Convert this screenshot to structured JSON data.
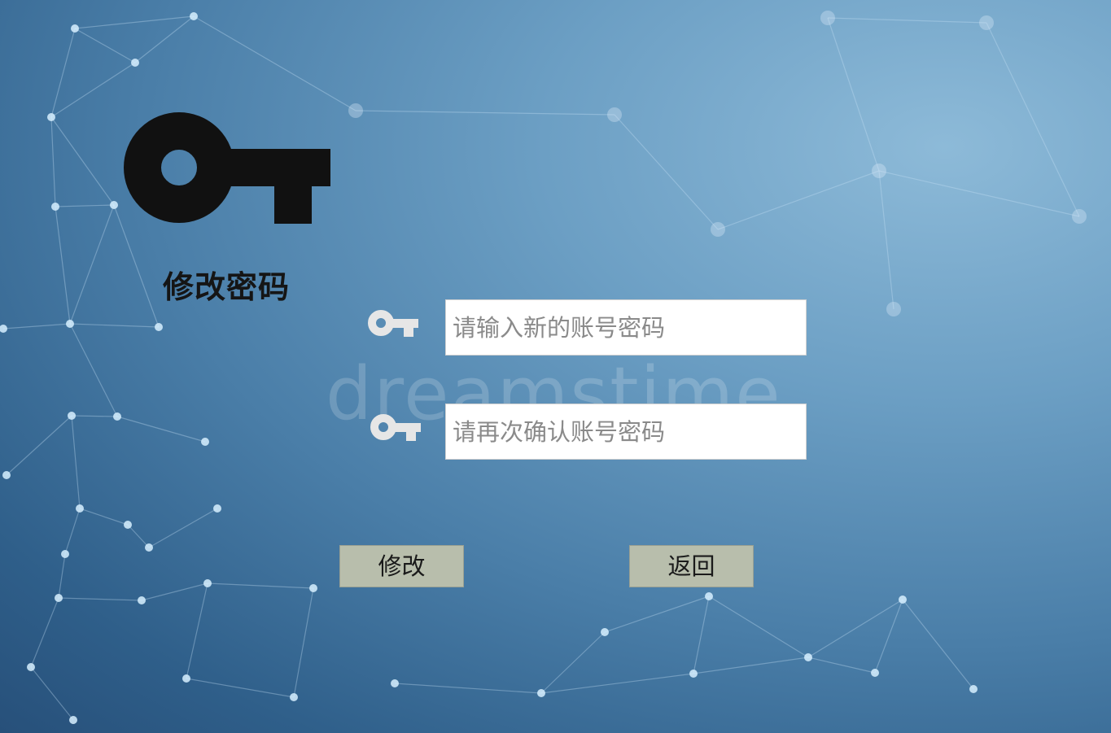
{
  "page": {
    "title": "修改密码"
  },
  "form": {
    "new_password_placeholder": "请输入新的账号密码",
    "confirm_password_placeholder": "请再次确认账号密码",
    "modify_label": "修改",
    "back_label": "返回"
  },
  "icons": {
    "title_icon": "key-icon",
    "field_icon": "key-icon"
  },
  "watermark": "dreamstime",
  "colors": {
    "title": "#151515",
    "key_large": "#111111",
    "key_small": "#e6e6e6",
    "button_bg": "#b8beac",
    "input_bg": "#ffffff",
    "placeholder": "#8a8a8a"
  }
}
